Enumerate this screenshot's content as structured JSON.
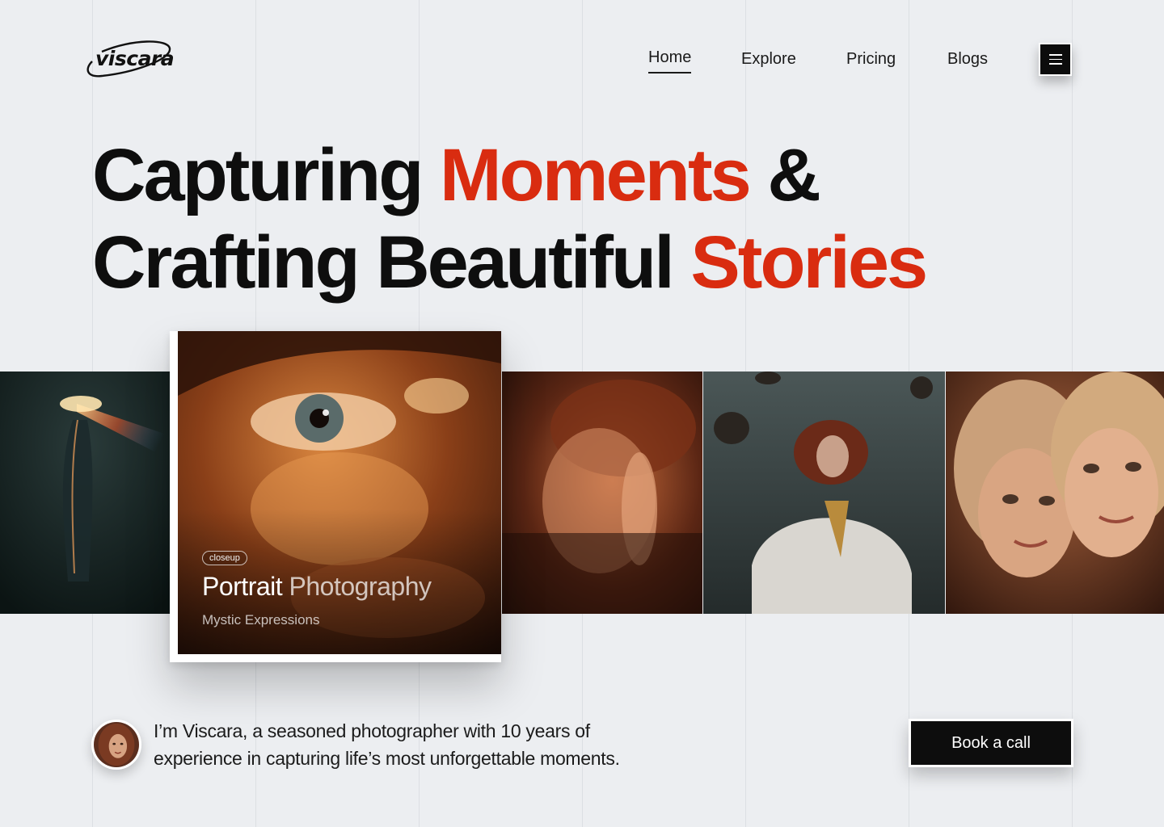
{
  "brand": {
    "logo_text": "viscara"
  },
  "nav": {
    "items": [
      {
        "label": "Home",
        "active": true
      },
      {
        "label": "Explore",
        "active": false
      },
      {
        "label": "Pricing",
        "active": false
      },
      {
        "label": "Blogs",
        "active": false
      }
    ],
    "menu_icon": "hamburger-menu-icon"
  },
  "hero": {
    "line1_part1": "Capturing ",
    "line1_accent": "Moments",
    "line1_part2": " &",
    "line2_part1": "Crafting Beautiful ",
    "line2_accent": "Stories",
    "accent_color": "#d92c10"
  },
  "featured": {
    "badge": "closeup",
    "title_primary": "Portrait",
    "title_secondary": " Photography",
    "subtitle": "Mystic Expressions"
  },
  "intro": {
    "text": "I’m Viscara, a seasoned photographer with 10 years of experience in capturing life’s most unforgettable moments."
  },
  "cta": {
    "label": "Book a call"
  }
}
